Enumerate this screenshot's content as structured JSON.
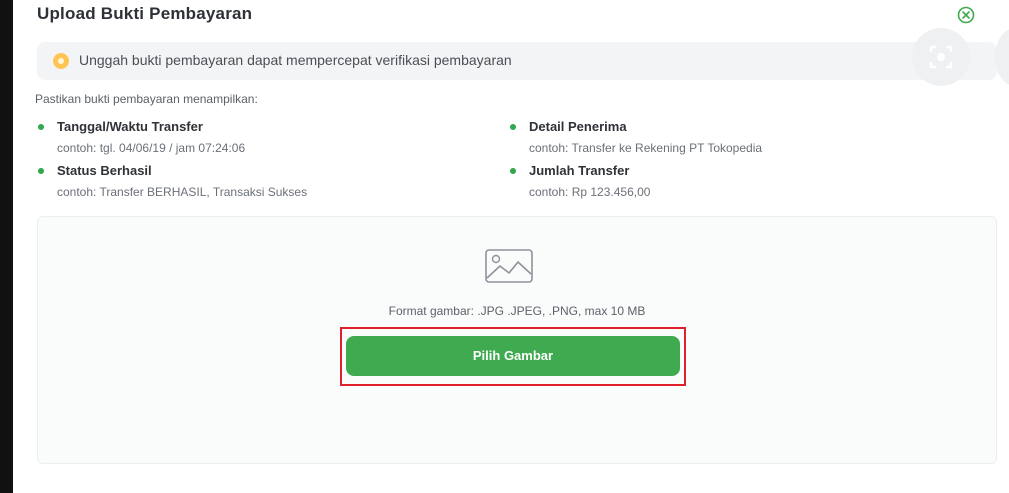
{
  "dialog": {
    "title": "Upload Bukti Pembayaran",
    "close_icon": "close-circle-icon"
  },
  "banner": {
    "icon": "info-dot-icon",
    "text": "Unggah bukti pembayaran dapat mempercepat verifikasi pembayaran"
  },
  "intro": "Pastikan bukti pembayaran menampilkan:",
  "requirements": [
    {
      "title": "Tanggal/Waktu Transfer",
      "example": "contoh: tgl. 04/06/19 / jam 07:24:06"
    },
    {
      "title": "Status Berhasil",
      "example": "contoh: Transfer BERHASIL, Transaksi Sukses"
    },
    {
      "title": "Detail Penerima",
      "example": "contoh: Transfer ke Rekening PT Tokopedia"
    },
    {
      "title": "Jumlah Transfer",
      "example": "contoh: Rp 123.456,00"
    }
  ],
  "upload": {
    "icon": "image-placeholder-icon",
    "format_text": "Format gambar: .JPG .JPEG, .PNG, max 10 MB",
    "button_label": "Pilih Gambar"
  },
  "colors": {
    "accent_green": "#3faa4f",
    "highlight_red": "#e0212d",
    "info_yellow": "#ffc453"
  }
}
